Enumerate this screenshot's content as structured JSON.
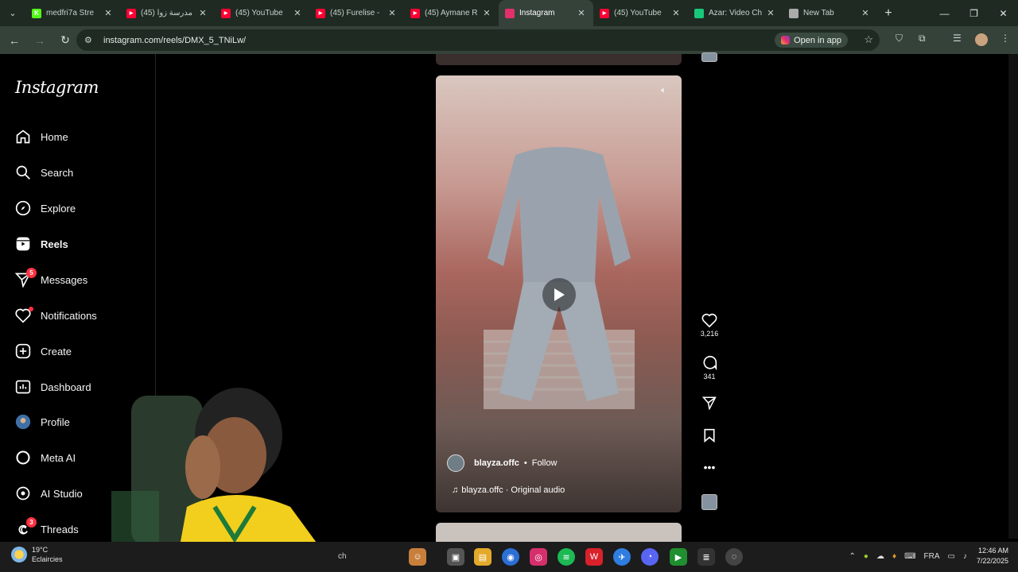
{
  "browser": {
    "tabs": [
      {
        "label": "medfri7a Stre",
        "icon": "kick-icon",
        "color": "#53fc18"
      },
      {
        "label": "(45) مدرسة زوا",
        "icon": "youtube-icon",
        "color": "#ff0033"
      },
      {
        "label": "(45) YouTube",
        "icon": "youtube-icon",
        "color": "#ff0033"
      },
      {
        "label": "(45) Furelise -",
        "icon": "youtube-icon",
        "color": "#ff0033"
      },
      {
        "label": "(45) Aymane R",
        "icon": "youtube-icon",
        "color": "#ff0033"
      },
      {
        "label": "Instagram",
        "icon": "instagram-icon",
        "color": "#e1306c",
        "active": true
      },
      {
        "label": "(45) YouTube",
        "icon": "youtube-icon",
        "color": "#ff0033"
      },
      {
        "label": "Azar: Video Ch",
        "icon": "azar-icon",
        "color": "#18c77a"
      },
      {
        "label": "New Tab",
        "icon": "chrome-icon",
        "color": "#aaaaaa"
      }
    ],
    "url": "instagram.com/reels/DMX_5_TNiLw/",
    "open_in_app": "Open in app"
  },
  "sidebar": {
    "logo": "Instagram",
    "items": [
      {
        "label": "Home",
        "icon": "home-icon"
      },
      {
        "label": "Search",
        "icon": "search-icon"
      },
      {
        "label": "Explore",
        "icon": "compass-icon"
      },
      {
        "label": "Reels",
        "icon": "reels-icon",
        "active": true
      },
      {
        "label": "Messages",
        "icon": "messenger-icon",
        "badge": "5"
      },
      {
        "label": "Notifications",
        "icon": "heart-icon",
        "dot": true
      },
      {
        "label": "Create",
        "icon": "plus-square-icon"
      },
      {
        "label": "Dashboard",
        "icon": "dashboard-icon"
      },
      {
        "label": "Profile",
        "icon": "avatar-icon"
      },
      {
        "label": "Meta AI",
        "icon": "meta-ai-icon"
      },
      {
        "label": "AI Studio",
        "icon": "ai-studio-icon"
      },
      {
        "label": "Threads",
        "icon": "threads-icon",
        "badge": "3"
      }
    ]
  },
  "reel": {
    "username": "blayza.offc",
    "separator": "•",
    "follow": "Follow",
    "audio": "blayza.offc · Original audio",
    "likes": "3,216",
    "comments": "341"
  },
  "taskbar": {
    "temperature": "19°C",
    "weather": "Eclaircies",
    "search_fragment": "ch",
    "language": "FRA",
    "time": "12:46 AM",
    "date": "7/22/2025"
  }
}
